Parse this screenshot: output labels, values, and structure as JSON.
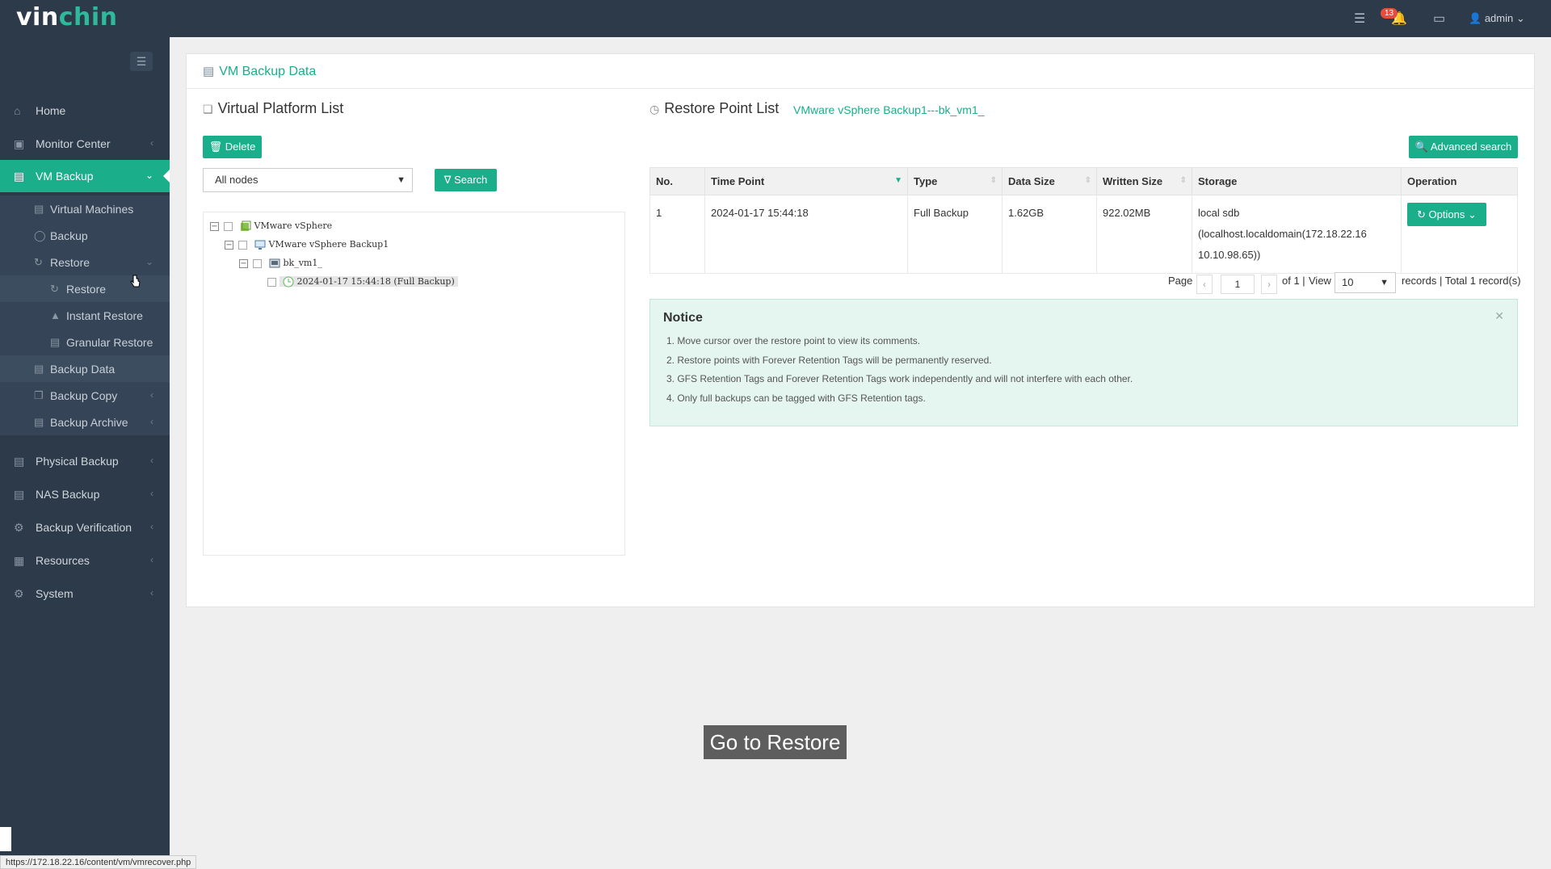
{
  "app": {
    "logo_left": "vin",
    "logo_right": "chin"
  },
  "topbar": {
    "notifications_count": "13",
    "user": "admin"
  },
  "sidebar": {
    "items": [
      {
        "label": "Home",
        "icon": "home-icon"
      },
      {
        "label": "Monitor Center",
        "icon": "monitor-icon"
      },
      {
        "label": "VM Backup",
        "icon": "vm-icon"
      },
      {
        "label": "Physical Backup",
        "icon": "physical-icon"
      },
      {
        "label": "NAS Backup",
        "icon": "nas-icon"
      },
      {
        "label": "Backup Verification",
        "icon": "verify-icon"
      },
      {
        "label": "Resources",
        "icon": "resources-icon"
      },
      {
        "label": "System",
        "icon": "system-icon"
      }
    ],
    "vm_sub": {
      "virtual_machines": "Virtual Machines",
      "backup": "Backup",
      "restore": "Restore",
      "restore_child": "Restore",
      "instant_restore": "Instant Restore",
      "granular_restore": "Granular Restore",
      "backup_data": "Backup Data",
      "backup_copy": "Backup Copy",
      "backup_archive": "Backup Archive"
    }
  },
  "panel": {
    "title": "VM Backup Data"
  },
  "platform": {
    "title": "Virtual Platform List",
    "delete_label": "Delete",
    "node_select": "All nodes",
    "search_label": "Search",
    "tree": {
      "root": "VMware vSphere",
      "host": "VMware vSphere Backup1",
      "vm": "bk_vm1_",
      "point": "2024-01-17 15:44:18 (Full Backup)"
    }
  },
  "restore_points": {
    "title": "Restore Point List",
    "subtitle": "VMware vSphere Backup1---bk_vm1_",
    "advanced_search": "Advanced search",
    "columns": [
      "No.",
      "Time Point",
      "Type",
      "Data Size",
      "Written Size",
      "Storage",
      "Operation"
    ],
    "rows": [
      {
        "no": "1",
        "time": "2024-01-17 15:44:18",
        "type": "Full Backup",
        "data_size": "1.62GB",
        "written_size": "922.02MB",
        "storage_1": "local sdb",
        "storage_2": "(localhost.localdomain(172.18.22.16",
        "storage_3": "10.10.98.65))",
        "operation": "Options"
      }
    ],
    "pager": {
      "page_label": "Page",
      "page_value": "1",
      "of_label": "of 1 |",
      "view_label": "View",
      "view_value": "10",
      "records_label": "records | Total 1 record(s)"
    }
  },
  "notice": {
    "title": "Notice",
    "lines": [
      "1. Move cursor over the restore point to view its comments.",
      "2. Restore points with Forever Retention Tags will be permanently reserved.",
      "3. GFS Retention Tags and Forever Retention Tags work independently and will not interfere with each other.",
      "4. Only full backups can be tagged with GFS Retention tags."
    ]
  },
  "caption": "Go to Restore",
  "status_bar_url": "https://172.18.22.16/content/vm/vmrecover.php",
  "colors": {
    "accent": "#1aae8a",
    "topbar": "#2c3a4a",
    "notice_bg": "#e5f5f0"
  }
}
